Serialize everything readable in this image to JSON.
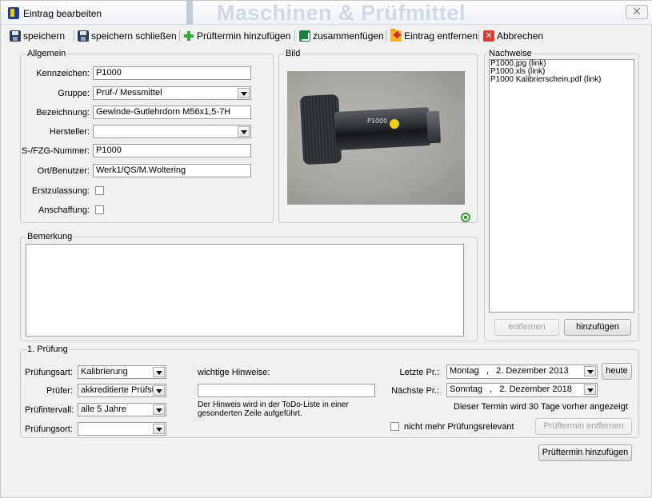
{
  "window": {
    "title": "Eintrag bearbeiten",
    "background_title": "Maschinen & Prüfmittel",
    "close_label": "⨉"
  },
  "toolbar": {
    "save": "speichern",
    "save_close": "speichern  schließen",
    "add_test_date": "Prüftermin hinzufügen",
    "merge": "zusammenfügen",
    "remove_entry": "Eintrag entfernen",
    "cancel": "Abbrechen"
  },
  "allgemein": {
    "legend": "Allgemein",
    "kennzeichen_label": "Kennzeichen:",
    "kennzeichen_value": "P1000",
    "gruppe_label": "Gruppe:",
    "gruppe_value": "Prüf-/ Messmittel",
    "bezeichnung_label": "Bezeichnung:",
    "bezeichnung_value": "Gewinde-Gutlehrdorn M56x1,5-7H",
    "hersteller_label": "Hersteller:",
    "hersteller_value": "",
    "sfzg_label": "S-/FZG-Nummer:",
    "sfzg_value": "P1000",
    "ort_label": "Ort/Benutzer:",
    "ort_value": "Werk1/QS/M.Woltering",
    "erstzulassung_label": "Erstzulassung:",
    "erstzulassung_checked": false,
    "anschaffung_label": "Anschaffung:",
    "anschaffung_checked": false
  },
  "bild": {
    "legend": "Bild",
    "photo_text": "P1000"
  },
  "nachweise": {
    "legend": "Nachweise",
    "items": [
      "P1000.jpg (link)",
      "P1000.xls (link)",
      "P1000 Kalibrierschein.pdf (link)"
    ],
    "remove_label": "entfernen",
    "add_label": "hinzufügen"
  },
  "bemerkung": {
    "legend": "Bemerkung",
    "value": ""
  },
  "pruefung": {
    "legend": "1. Prüfung",
    "art_label": "Prüfungsart:",
    "art_value": "Kalibrierung",
    "pruefer_label": "Prüfer:",
    "pruefer_value": "akkreditierte Prüfstell",
    "intervall_label": "Prüfintervall:",
    "intervall_value": "alle 5 Jahre",
    "ort_label": "Prüfungsort:",
    "ort_value": "",
    "hinweise_label": "wichtige Hinweise:",
    "hinweise_value": "",
    "hinweise_note": "Der Hinweis wird in der ToDo-Liste in einer gesonderten Zeile aufgeführt.",
    "letzte_label": "Letzte Pr.:",
    "letzte_value": "Montag   ,   2. Dezember 2013",
    "heute_label": "heute",
    "naechste_label": "Nächste Pr.:",
    "naechste_value": "Sonntag   ,   2. Dezember 2018",
    "reminder_text": "Dieser Termin wird 30 Tage vorher angezeigt",
    "nicht_mehr_label": "nicht mehr Prüfungsrelevant",
    "nicht_mehr_checked": false,
    "remove_date_label": "Prüftermin entfernen"
  },
  "footer": {
    "add_date_label": "Prüftermin hinzufügen"
  }
}
